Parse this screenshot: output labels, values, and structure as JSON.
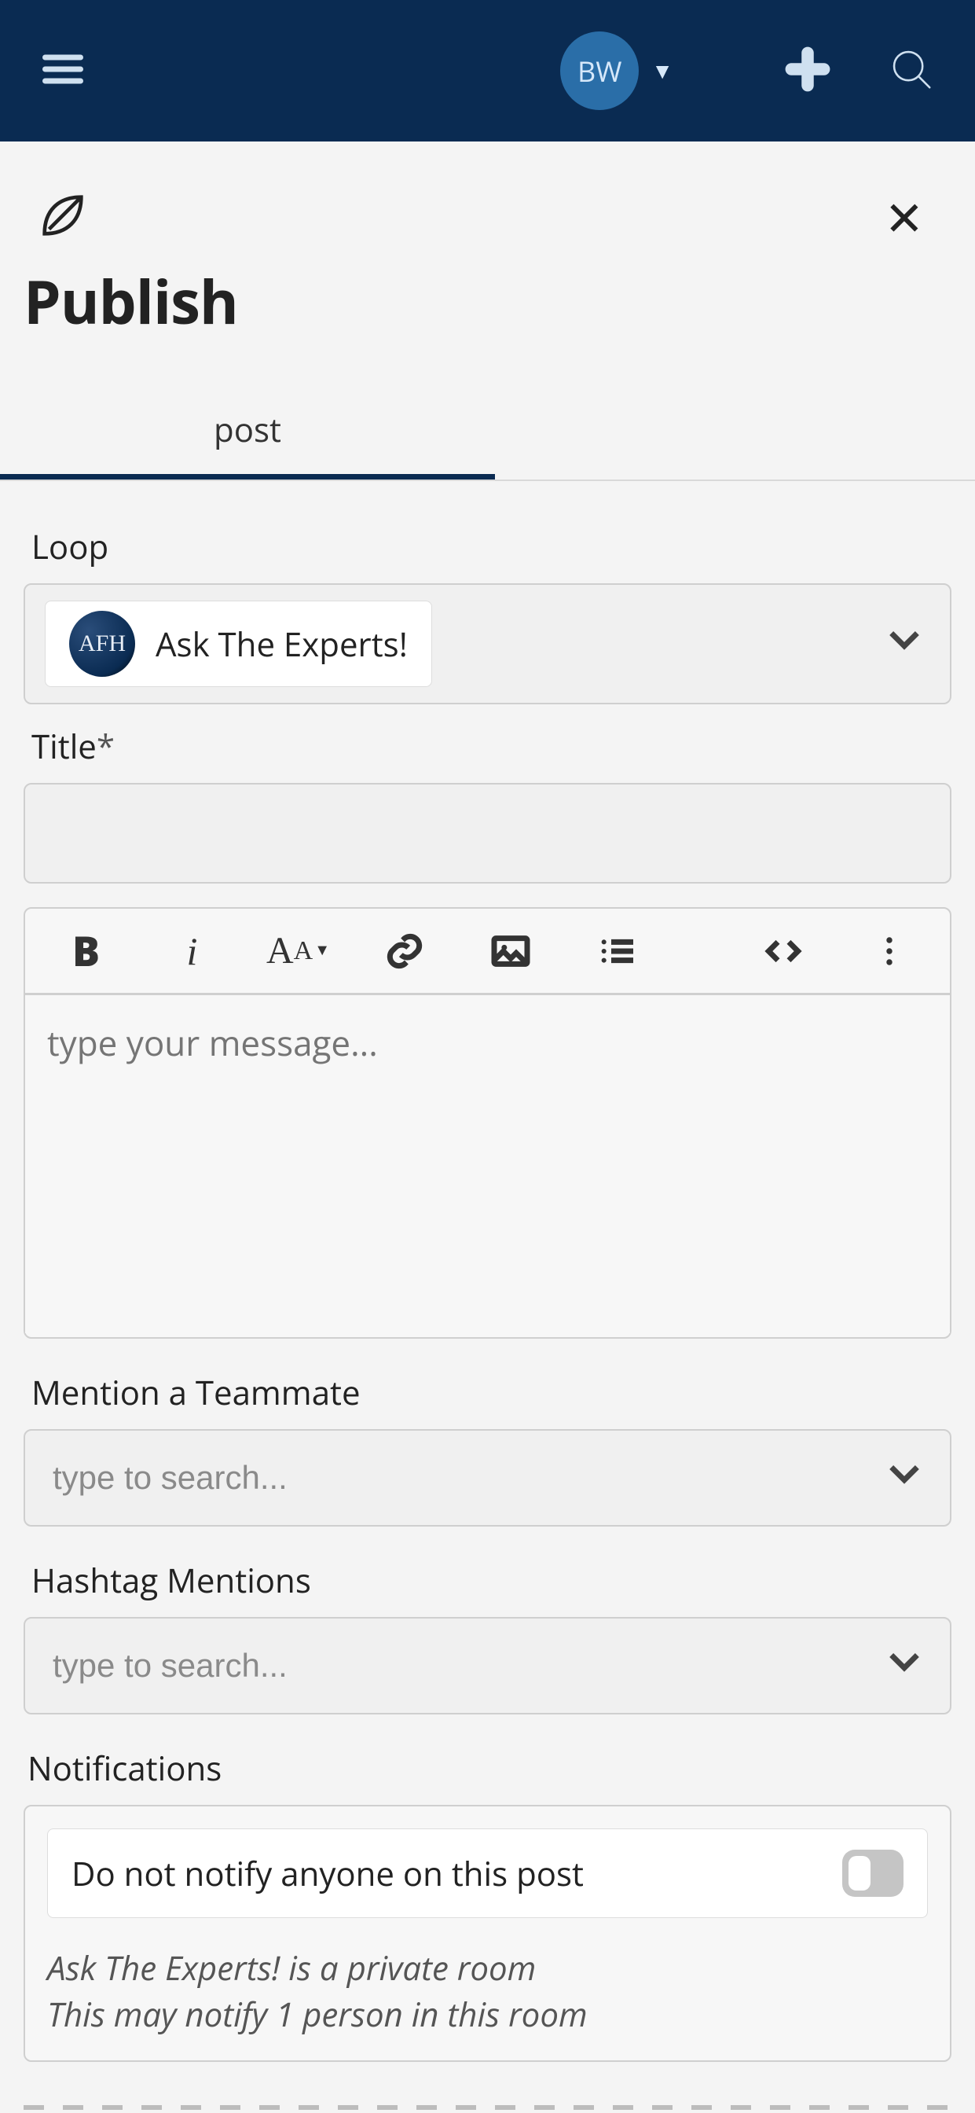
{
  "header": {
    "user_initials": "BW"
  },
  "panel": {
    "title": "Publish"
  },
  "tabs": {
    "active": "post"
  },
  "form": {
    "loop": {
      "label": "Loop",
      "selected_avatar_text": "AFH",
      "selected_name": "Ask The Experts!"
    },
    "title": {
      "label": "Title",
      "required_marker": "*",
      "value": ""
    },
    "editor": {
      "placeholder": "type your message...",
      "toolbar": {
        "bold": "B",
        "italic": "i",
        "font_big": "A",
        "font_small": "A"
      }
    },
    "mention": {
      "label": "Mention a Teammate",
      "placeholder": "type to search..."
    },
    "hashtag": {
      "label": "Hashtag Mentions",
      "placeholder": "type to search..."
    },
    "notifications": {
      "label": "Notifications",
      "toggle_label": "Do not notify anyone on this post",
      "toggle_on": false,
      "info_line1": "Ask The Experts! is a private room",
      "info_line2": "This may notify 1 person in this room"
    }
  }
}
